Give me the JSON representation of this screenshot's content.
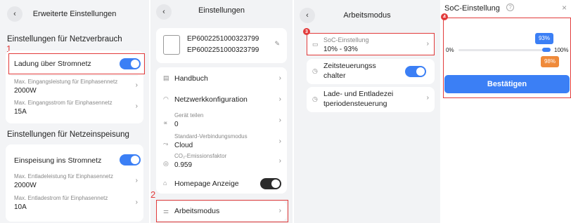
{
  "p1": {
    "title": "Erweiterte Einstellungen",
    "sec1": "Einstellungen für Netzverbrauch",
    "toggle1_label": "Ladung über Stromnetz",
    "in_pow_label": "Max. Eingangsleistung für Einphasennetz",
    "in_pow_val": "2000W",
    "in_cur_label": "Max. Eingangsstrom für Einphasennetz",
    "in_cur_val": "15A",
    "sec2": "Einstellungen für Netzeinspeisung",
    "toggle2_label": "Einspeisung ins Stromnetz",
    "dis_pow_label": "Max. Entladeleistung für Einphasennetz",
    "dis_pow_val": "2000W",
    "dis_cur_label": "Max. Entladestrom für Einphasennetz",
    "dis_cur_val": "10A",
    "marker": "1"
  },
  "p2": {
    "title": "Einstellungen",
    "dev1": "EP6002251000323799",
    "dev2": "EP6002251000323799",
    "handbuch": "Handbuch",
    "netzwerk": "Netzwerkkonfiguration",
    "share_label": "Gerät teilen",
    "share_val": "0",
    "conn_label": "Standard-Verbindungsmodus",
    "conn_val": "Cloud",
    "co2_label": "CO₂-Emissionsfaktor",
    "co2_val": "0.959",
    "home": "Homepage Anzeige",
    "arbeit": "Arbeitsmodus",
    "marker": "2"
  },
  "p3": {
    "title": "Arbeitsmodus",
    "soc_label": "SoC-Einstellung",
    "soc_val": "10% - 93%",
    "zeit1": "Zeitsteuerungss",
    "zeit2": "chalter",
    "lade1": "Lade- und Entladezei",
    "lade2": "tperiodensteuerung",
    "marker": "3"
  },
  "p4": {
    "title": "SoC-Einstellung",
    "help": "?",
    "close": "×",
    "min": "0%",
    "max": "100%",
    "upper": "93%",
    "lower": "98%",
    "confirm": "Bestätigen",
    "marker": "4"
  },
  "colors": {
    "accent": "#3b7ff5",
    "orange": "#ef8a3a",
    "red": "#e23b3b"
  }
}
